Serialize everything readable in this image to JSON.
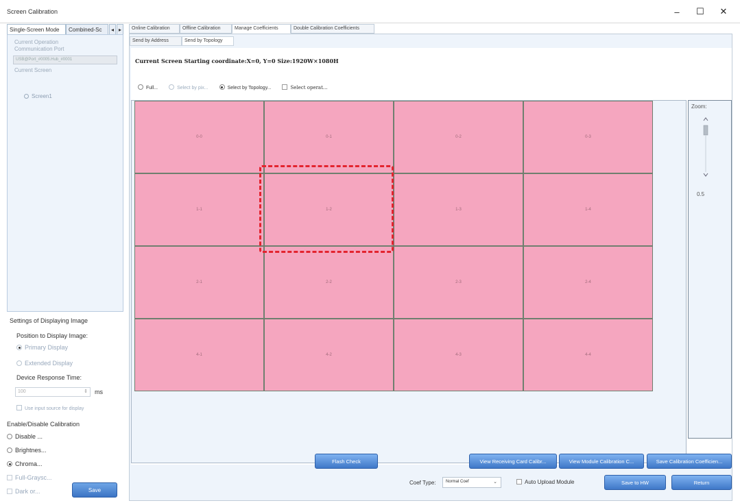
{
  "window": {
    "title": "Screen Calibration",
    "minimize": "–",
    "maximize": "☐",
    "close": "✕"
  },
  "left_tabs": {
    "tab1": "Single-Screen Mode",
    "tab2": "Combined-Sc",
    "arrow_left": "◂",
    "arrow_right": "▸"
  },
  "left_panel": {
    "current_operation_label": "Current Operation",
    "communication_port_label": "Communication Port",
    "port_value": "USB@Port_#0005.Hub_#0001",
    "current_screen_label": "Current Screen",
    "screen_item": "Screen1"
  },
  "display_settings": {
    "title": "Settings of Displaying Image",
    "position_label": "Position to Display Image:",
    "primary_display": "Primary Display",
    "extended_display": "Extended Display",
    "response_time_label": "Device Response Time:",
    "response_time_value": "100",
    "unit": "ms",
    "use_input_source": "Use input source for display"
  },
  "calibration": {
    "title": "Enable/Disable Calibration",
    "disable": "Disable ...",
    "brightness": "Brightnes...",
    "chroma": "Chroma...",
    "full_grayscale": "Full-Graysc...",
    "dark_or": "Dark or...",
    "save": "Save"
  },
  "main_tabs": [
    "Online Calibration",
    "Offline Calibration",
    "Manage Coefficients",
    "Double Calibration Coefficients"
  ],
  "sub_tabs": [
    "Send by Address",
    "Send by Topology"
  ],
  "current_screen_info": "Current Screen   Starting coordinate:X=0, Y=0   Size:1920W×1080H",
  "mode_options": {
    "full": "Full...",
    "select_by_pix": "Select by pix...",
    "select_by_topology": "Select by Topology...",
    "select_operat": "Select operat..."
  },
  "grid": {
    "rows": [
      [
        "0-0",
        "0-1",
        "0-2",
        "0-3"
      ],
      [
        "1-1",
        "1-2",
        "1-3",
        "1-4"
      ],
      [
        "2-1",
        "2-2",
        "2-3",
        "2-4"
      ],
      [
        "4-1",
        "4-2",
        "4-3",
        "4-4"
      ]
    ],
    "cell_color": "#f5a6bf",
    "highlight_color": "#e3232e"
  },
  "zoom": {
    "label": "Zoom:",
    "value": "0.5"
  },
  "buttons": {
    "flash_check": "Flash Check",
    "view_receiving": "View Receiving Card Calibr...",
    "view_module": "View Module Calibration C...",
    "save_coefficients": "Save Calibration Coefficien...",
    "save_to_hw": "Save to HW",
    "return": "Return"
  },
  "coef": {
    "label": "Coef Type:",
    "value": "Normal Coef",
    "auto_upload": "Auto Upload Module"
  }
}
